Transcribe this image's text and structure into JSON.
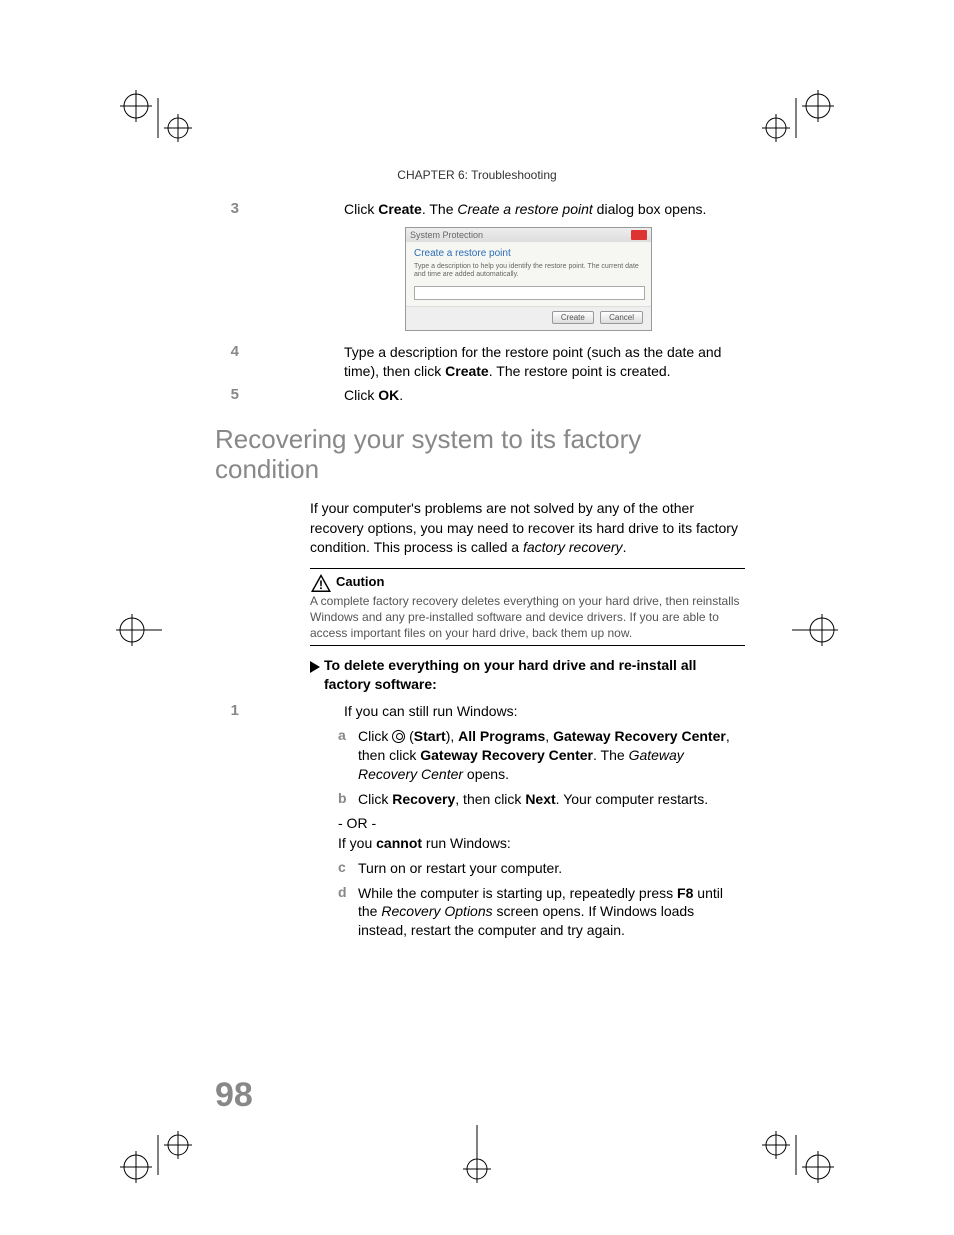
{
  "header": "CHAPTER 6: Troubleshooting",
  "step3": {
    "num": "3",
    "pre": "Click ",
    "bold1": "Create",
    "mid": ". The ",
    "ital": "Create a restore point",
    "post": " dialog box opens."
  },
  "dialog": {
    "title": "System Protection",
    "heading": "Create a restore point",
    "desc": "Type a description to help you identify the restore point. The current date and time are added automatically.",
    "btn_create": "Create",
    "btn_cancel": "Cancel"
  },
  "step4": {
    "num": "4",
    "pre": "Type a description for the restore point (such as the date and time), then click ",
    "bold1": "Create",
    "post": ". The restore point is created."
  },
  "step5": {
    "num": "5",
    "pre": "Click ",
    "bold1": "OK",
    "post": "."
  },
  "section_title": "Recovering your system to its factory condition",
  "intro": {
    "pre": "If your computer's problems are not solved by any of the other recovery options, you may need to recover its hard drive to its factory condition. This process is called a ",
    "ital": "factory recovery",
    "post": "."
  },
  "caution": {
    "title": "Caution",
    "body": "A complete factory recovery deletes everything on your hard drive, then reinstalls Windows and any pre-installed software and device drivers. If you are able to access important files on your hard drive, back them up now."
  },
  "task_heading": "To delete everything on your hard drive and re-install all factory software:",
  "s1": {
    "num": "1",
    "text": "If you can still run Windows:"
  },
  "sa": {
    "letter": "a",
    "pre": "Click ",
    "paren_open": " (",
    "start": "Start",
    "paren_close": "), ",
    "allprog": "All Programs",
    "comma1": ", ",
    "grc1": "Gateway Recovery Center",
    "mid": ", then click ",
    "grc2": "Gateway Recovery Center",
    "mid2": ". The ",
    "ital": "Gateway Recovery Center",
    "post": " opens."
  },
  "sb": {
    "letter": "b",
    "pre": "Click ",
    "recovery": "Recovery",
    "mid": ", then click ",
    "next": "Next",
    "post": ". Your computer restarts."
  },
  "or": "- OR -",
  "cannot_line": {
    "pre": "If you ",
    "bold": "cannot",
    "post": " run Windows:"
  },
  "sc": {
    "letter": "c",
    "text": "Turn on or restart your computer."
  },
  "sd": {
    "letter": "d",
    "pre": "While the computer is starting up, repeatedly press ",
    "f8": "F8",
    "mid": " until the ",
    "ital": "Recovery Options",
    "post": " screen opens. If Windows loads instead, restart the computer and try again."
  },
  "page_number": "98"
}
